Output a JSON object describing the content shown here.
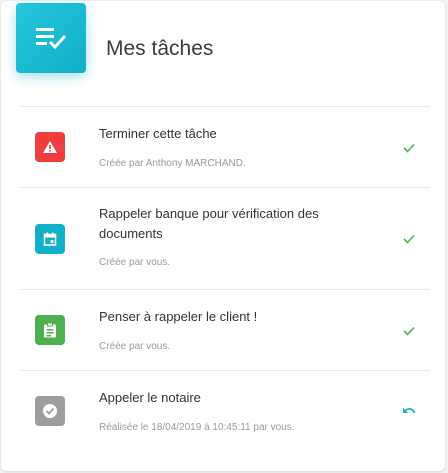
{
  "header": {
    "title": "Mes tâches",
    "icon": "task-list-check-icon",
    "accent": "#18b9d0"
  },
  "tasks": [
    {
      "label": "Terminer cette tâche",
      "meta": "Créée par Anthony MARCHAND.",
      "icon": "warning-icon",
      "color": "#f03d3d",
      "action": "check-icon"
    },
    {
      "label": "Rappeler banque pour vérification des documents",
      "meta": "Créée par vous.",
      "icon": "calendar-icon",
      "color": "#10b0c6",
      "action": "check-icon"
    },
    {
      "label": "Penser à rappeler le client !",
      "meta": "Créée par vous.",
      "icon": "clipboard-icon",
      "color": "#4caf50",
      "action": "check-icon"
    },
    {
      "label": "Appeler le notaire",
      "meta": "Réalisée le 18/04/2019 à 10:45:11 par vous.",
      "icon": "check-circle-icon",
      "color": "#9e9e9e",
      "action": "undo-icon"
    }
  ]
}
